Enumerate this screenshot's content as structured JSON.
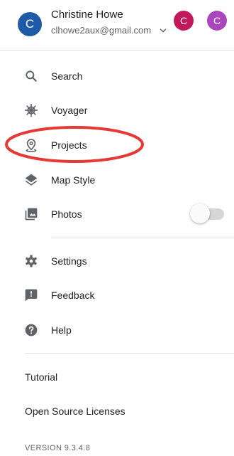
{
  "account": {
    "name": "Christine Howe",
    "email": "clhowe2aux@gmail.com",
    "avatar_letter": "C",
    "alt_accounts": [
      {
        "letter": "C",
        "color": "#c2185b"
      },
      {
        "letter": "C",
        "color": "#ab47bc"
      }
    ],
    "avatar_color": "#1e5aa8"
  },
  "menu": {
    "items": [
      {
        "label": "Search",
        "icon": "search-icon"
      },
      {
        "label": "Voyager",
        "icon": "ship-wheel-icon"
      },
      {
        "label": "Projects",
        "icon": "map-pin-icon"
      },
      {
        "label": "Map Style",
        "icon": "layers-icon"
      },
      {
        "label": "Photos",
        "icon": "photos-icon",
        "toggle_on": false
      },
      {
        "label": "Settings",
        "icon": "gear-icon"
      },
      {
        "label": "Feedback",
        "icon": "feedback-icon"
      },
      {
        "label": "Help",
        "icon": "help-icon"
      }
    ]
  },
  "links": {
    "tutorial": "Tutorial",
    "licenses": "Open Source Licenses"
  },
  "version": "VERSION 9.3.4.8",
  "colors": {
    "icon": "#5f6368",
    "annotation": "#e53935"
  }
}
